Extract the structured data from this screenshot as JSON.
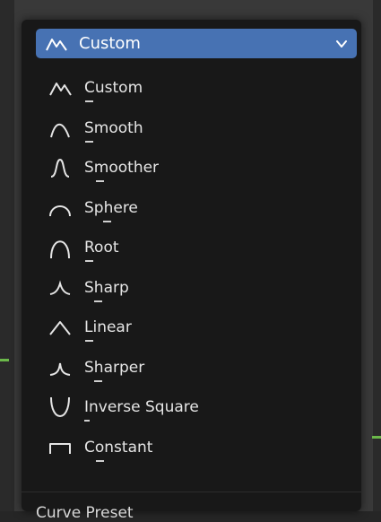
{
  "dropdown": {
    "selected_label": "Custom",
    "icon": "custom-curve-icon"
  },
  "menu": {
    "items": [
      {
        "label": "Custom",
        "icon": "custom-curve-icon",
        "mnemonic_index": 0
      },
      {
        "label": "Smooth",
        "icon": "smooth-curve-icon",
        "mnemonic_index": 0
      },
      {
        "label": "Smoother",
        "icon": "smoother-curve-icon",
        "mnemonic_index": 1
      },
      {
        "label": "Sphere",
        "icon": "sphere-curve-icon",
        "mnemonic_index": 2
      },
      {
        "label": "Root",
        "icon": "root-curve-icon",
        "mnemonic_index": 0
      },
      {
        "label": "Sharp",
        "icon": "sharp-curve-icon",
        "mnemonic_index": 1
      },
      {
        "label": "Linear",
        "icon": "linear-curve-icon",
        "mnemonic_index": 0
      },
      {
        "label": "Sharper",
        "icon": "sharper-curve-icon",
        "mnemonic_index": 1
      },
      {
        "label": "Inverse Square",
        "icon": "inverse-square-curve-icon",
        "mnemonic_index": 0
      },
      {
        "label": "Constant",
        "icon": "constant-curve-icon",
        "mnemonic_index": 1
      }
    ]
  },
  "footer": {
    "title": "Curve Preset"
  },
  "colors": {
    "accent": "#4772b3",
    "menu_bg": "#181818",
    "text": "#e5e5e5"
  }
}
